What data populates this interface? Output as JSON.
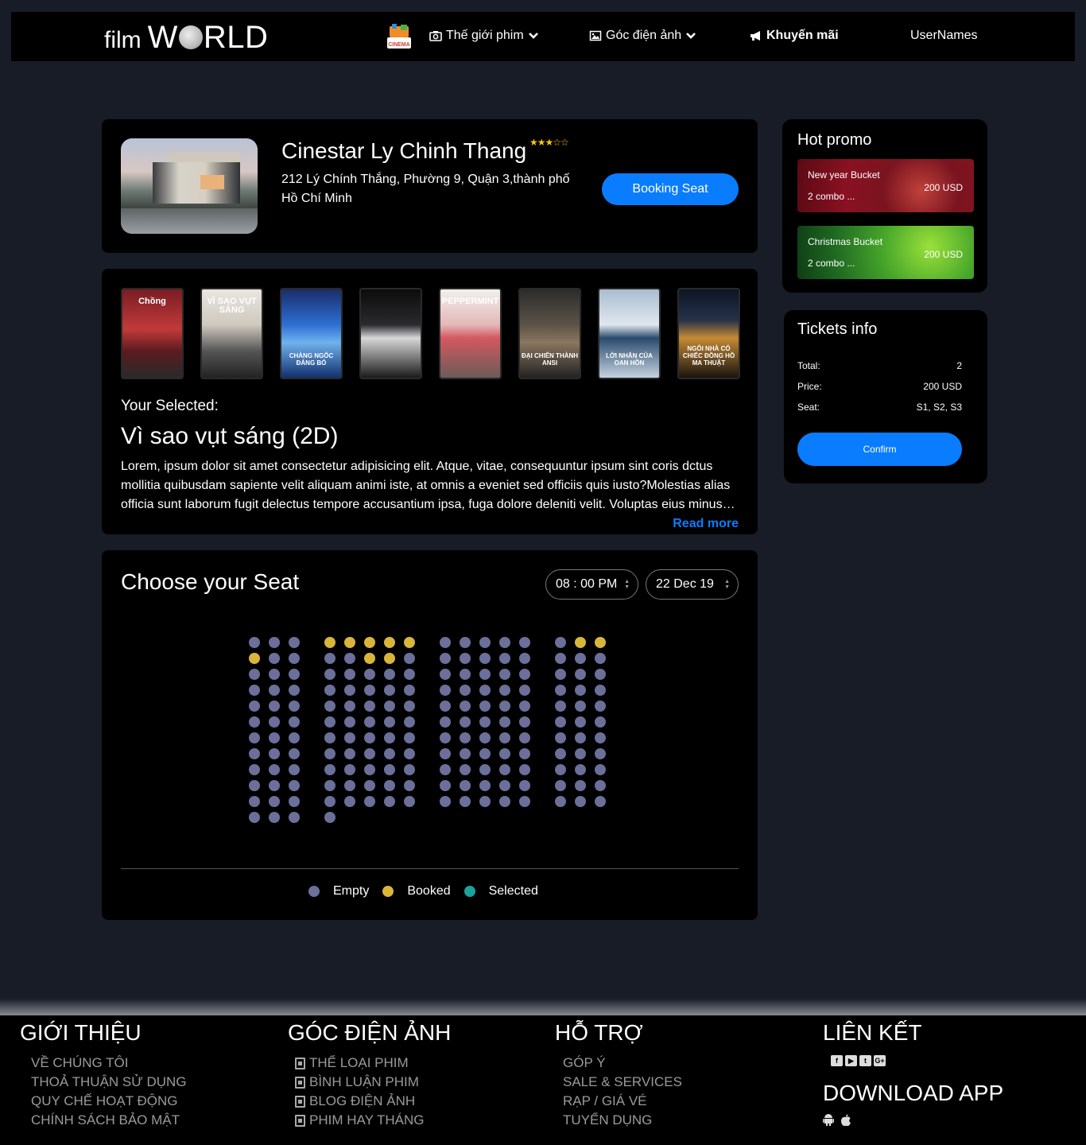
{
  "navbar": {
    "logo_film": "film",
    "logo_world_w": "W",
    "logo_world_rest": "RLD",
    "cinema_badge": "CINEMA",
    "items": [
      {
        "label": "Thế giới phim",
        "icon": "camera-icon"
      },
      {
        "label": "Góc điện ảnh",
        "icon": "image-icon"
      },
      {
        "label": "Khuyến mãi",
        "icon": "megaphone-icon"
      }
    ],
    "username": "UserNames"
  },
  "cinema": {
    "name": "Cinestar Ly Chinh Thang",
    "rating_stars": "★★★☆☆",
    "rating": 3,
    "address": "212 Lý Chính Thắng, Phường 9, Quận 3,thành phố Hồ Chí Minh",
    "booking_button": "Booking Seat"
  },
  "movies": {
    "posters": [
      {
        "topcap": "Chồng",
        "cap": "",
        "bg": "linear-gradient(180deg,#7a1d24,#c23a3a 45%,#5b1b1f 70%,#2a2a2a)"
      },
      {
        "topcap": "VÌ SAO VỤT SÁNG",
        "cap": "",
        "bg": "linear-gradient(180deg,#e9e6e0,#cfc9bf 40%,#555 70%,#222)"
      },
      {
        "topcap": "",
        "cap": "CHÀNG NGỐC ĐÁNG BỎ",
        "bg": "linear-gradient(180deg,#1a2d6b,#2e6fd1 40%,#6fb2ee 60%,#13306e)"
      },
      {
        "topcap": "",
        "cap": "",
        "bg": "linear-gradient(180deg,#0c0c0c,#2a2a2e 40%,#d8d8d8 55%,#1b1b1b)"
      },
      {
        "topcap": "PEPPERMINT",
        "cap": "",
        "bg": "linear-gradient(180deg,#f1f0ec,#e3b8b8 40%,#d45860 55%,#6a5c58)"
      },
      {
        "topcap": "",
        "cap": "ĐẠI CHIẾN THÀNH ANSI",
        "bg": "linear-gradient(180deg,#2c2c2c,#5b5348 40%,#8b7660 60%,#222)"
      },
      {
        "topcap": "",
        "cap": "LỜI NHẮN CỦA OAN HỒN",
        "bg": "linear-gradient(180deg,#a9bdd0,#dfe7ee 40%,#2a4b6e 55%,#c4d2df)"
      },
      {
        "topcap": "",
        "cap": "NGÔI NHÀ CÓ CHIẾC ĐỒNG HỒ MA THUẬT",
        "bg": "linear-gradient(180deg,#0d1524,#27324a 35%,#c58a34 55%,#1a1410)"
      }
    ],
    "selected_label": "Your Selected:",
    "selected_title": "Vì sao vụt sáng (2D)",
    "description": "Lorem, ipsum dolor sit amet consectetur adipisicing elit. Atque, vitae, consequuntur ipsum sint coris dctus mollitia quibusdam sapiente velit aliquam animi iste, at omnis a eveniet sed officiis quis iusto?Molestias alias officia sunt laborum fugit delectus tempore accusantium ipsa, fuga dolore deleniti velit. Voluptas eius minus quibusdam.",
    "read_more": "Read more"
  },
  "seating": {
    "title": "Choose your Seat",
    "time": "08 : 00 PM",
    "date": "22 Dec 19",
    "blocks": [
      {
        "cols": 3,
        "rows": 12,
        "booked": [
          [
            1,
            0
          ]
        ]
      },
      {
        "cols": 5,
        "rows": 11,
        "booked": [
          [
            0,
            0
          ],
          [
            0,
            1
          ],
          [
            0,
            2
          ],
          [
            0,
            3
          ],
          [
            0,
            4
          ],
          [
            1,
            2
          ],
          [
            1,
            3
          ]
        ],
        "extra_row_cols": 1
      },
      {
        "cols": 5,
        "rows": 11,
        "booked": []
      },
      {
        "cols": 3,
        "rows": 11,
        "booked": [
          [
            0,
            1
          ],
          [
            0,
            2
          ]
        ]
      }
    ],
    "legend": [
      {
        "label": "Empty",
        "color": "#6b6f9a"
      },
      {
        "label": "Booked",
        "color": "#d9b53a"
      },
      {
        "label": "Selected",
        "color": "#1aa39a"
      }
    ]
  },
  "promo": {
    "title": "Hot promo",
    "items": [
      {
        "name": "New year Bucket",
        "combo": "2 combo ...",
        "price": "200 USD"
      },
      {
        "name": "Christmas Bucket",
        "combo": "2 combo ...",
        "price": "200 USD"
      }
    ]
  },
  "tickets": {
    "title": "Tickets info",
    "rows": [
      {
        "label": "Total:",
        "value": "2"
      },
      {
        "label": "Price:",
        "value": "200 USD"
      },
      {
        "label": "Seat:",
        "value": "S1, S2, S3"
      }
    ],
    "confirm": "Confirm"
  },
  "footer": {
    "cols": [
      {
        "title": "GIỚI THIỆU",
        "links": [
          "VỀ CHÚNG TÔI",
          "THOẢ THUẬN SỬ DỤNG",
          "QUY CHẾ HOẠT ĐỘNG",
          "CHÍNH SÁCH BẢO MẬT"
        ],
        "icons": false
      },
      {
        "title": "GÓC ĐIỆN ẢNH",
        "links": [
          "THỂ LOẠI PHIM",
          "BÌNH LUẬN PHIM",
          "BLOG ĐIỆN ẢNH",
          "PHIM HAY THÁNG"
        ],
        "icons": true
      },
      {
        "title": "HỖ TRỢ",
        "links": [
          "GÓP Ý",
          "SALE & SERVICES",
          "RẠP / GIÁ VÉ",
          "TUYỂN DỤNG"
        ],
        "icons": false
      }
    ],
    "links_title": "LIÊN KẾT",
    "social": [
      "facebook-icon",
      "youtube-icon",
      "twitter-icon",
      "google-plus-icon"
    ],
    "download_title": "DOWNLOAD APP",
    "apps": [
      "android-icon",
      "apple-icon"
    ]
  }
}
